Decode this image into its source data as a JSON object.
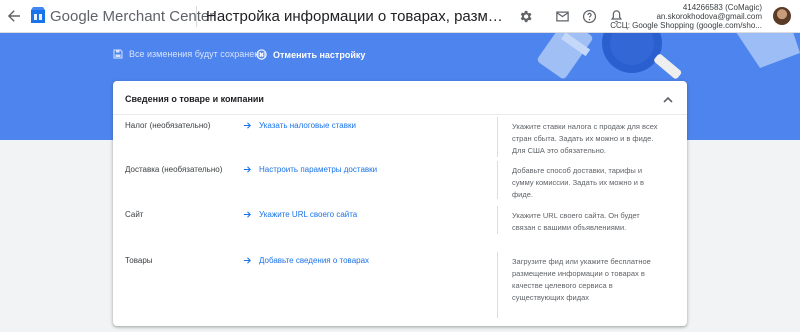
{
  "header": {
    "product_name": "Google Merchant Center",
    "page_title": "Настройка информации о товарах, размещенной бес…",
    "account_line1": "414266583 (CoMagic)",
    "account_line2": "an.skorokhodova@gmail.com",
    "account_line3": "ССЦ: Google Shopping (google.com/sho..."
  },
  "band": {
    "save_status": "Все изменения будут сохранены",
    "cancel_label": "Отменить настройку"
  },
  "card": {
    "title": "Сведения о товаре и компании",
    "rows": [
      {
        "label": "Налог (необязательно)",
        "link": "Указать налоговые ставки",
        "help": "Укажите ставки налога с продаж для всех стран сбыта. Задать их можно и в фиде. Для США это обязательно."
      },
      {
        "label": "Доставка (необязательно)",
        "link": "Настроить параметры доставки",
        "help": "Добавьте способ доставки, тарифы и сумму комиссии. Задать их можно и в фиде."
      },
      {
        "label": "Сайт",
        "link": "Укажите URL своего сайта",
        "help": "Укажите URL своего сайта. Он будет связан с вашими объявлениями."
      },
      {
        "label": "Товары",
        "link": "Добавьте сведения о товарах",
        "help": "Загрузите фид или укажите бесплатное размещение информации о товарах в качестве целевого сервиса в существующих фидах"
      }
    ]
  },
  "colors": {
    "brand_blue": "#4e84ee",
    "link_blue": "#1a73e8"
  }
}
